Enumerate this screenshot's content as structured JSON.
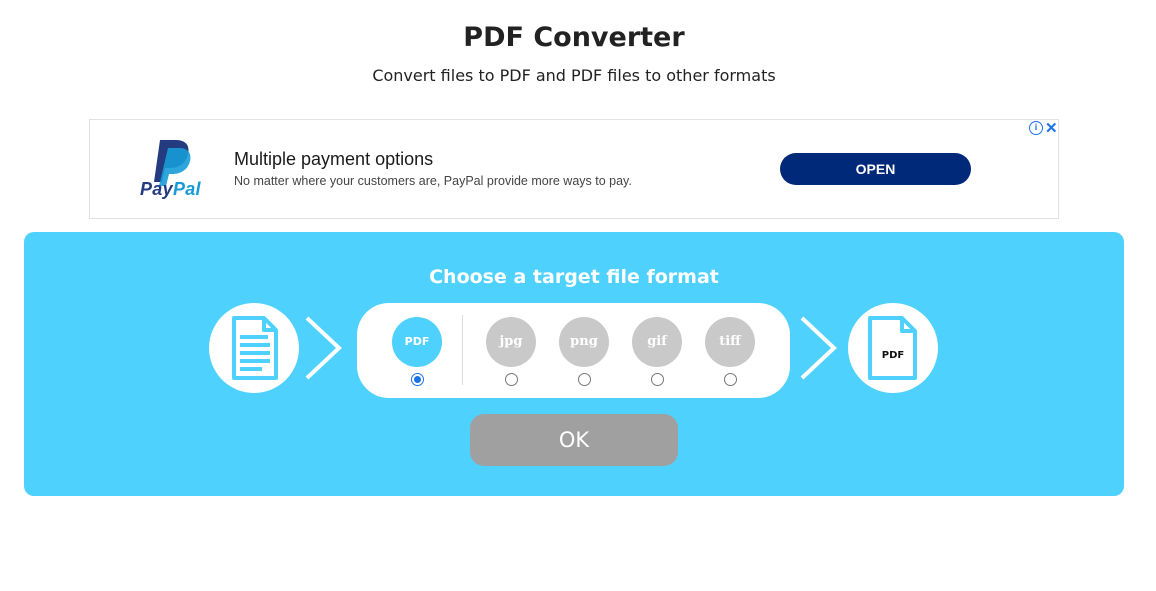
{
  "header": {
    "title": "PDF Converter",
    "subtitle": "Convert files to PDF and PDF files to other formats"
  },
  "ad": {
    "brand_pay": "Pay",
    "brand_pal": "Pal",
    "headline": "Multiple payment options",
    "body": "No matter where your customers are, PayPal provide more ways to pay.",
    "cta": "OPEN",
    "info_icon": "i",
    "close_icon": "✕",
    "colors": {
      "cta": "#00297a",
      "logo_dark": "#253b80",
      "logo_light": "#179bd7"
    }
  },
  "converter": {
    "heading": "Choose a target file format",
    "target_file_label": "PDF",
    "formats": [
      {
        "label": "PDF",
        "selected": true
      },
      {
        "label": "jpg",
        "selected": false
      },
      {
        "label": "png",
        "selected": false
      },
      {
        "label": "gif",
        "selected": false
      },
      {
        "label": "tiff",
        "selected": false
      }
    ],
    "ok_label": "OK",
    "colors": {
      "panel": "#4fd1fe",
      "ok_button": "#a0a0a0",
      "inactive_format": "#c9c9c9"
    }
  }
}
